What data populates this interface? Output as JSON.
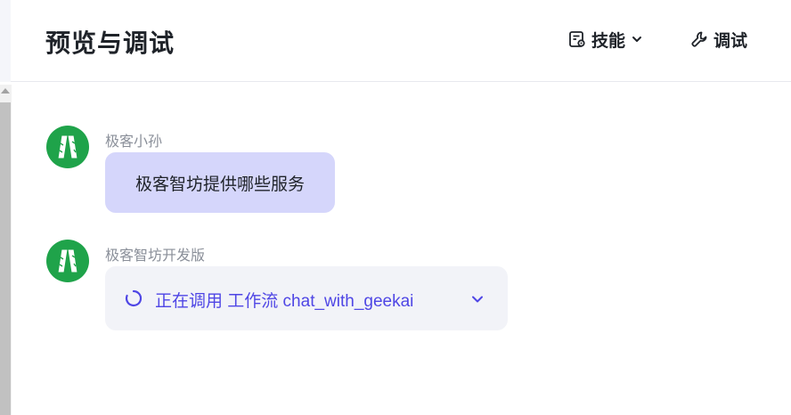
{
  "header": {
    "title": "预览与调试",
    "skills_label": "技能",
    "debug_label": "调试"
  },
  "messages": [
    {
      "sender": "极客小孙",
      "text": "极客智坊提供哪些服务"
    },
    {
      "sender": "极客智坊开发版",
      "tool_call_status": "正在调用 工作流 chat_with_geekai"
    }
  ],
  "colors": {
    "avatar_bg": "#1fa34a",
    "user_bubble_bg": "#d5d6fb",
    "tool_card_bg": "#f2f3f8",
    "accent": "#4f46e5"
  },
  "icons": {
    "skills": "skill-doc-icon",
    "skills_dropdown": "chevron-down-icon",
    "debug": "wrench-icon",
    "avatar": "geekai-logo",
    "loading": "spinner-icon",
    "expand": "chevron-down-icon"
  }
}
